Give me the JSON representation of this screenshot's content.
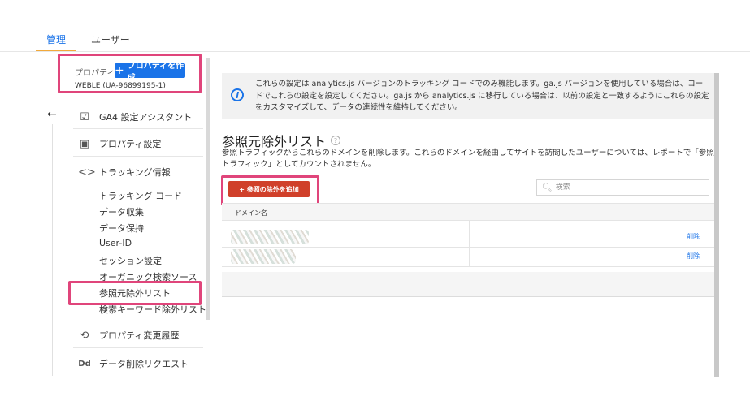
{
  "tabs": [
    {
      "label": "管理",
      "active": true
    },
    {
      "label": "ユーザー",
      "active": false
    }
  ],
  "sidebar": {
    "property_label": "プロパティ",
    "create_property_label": "プロパティを作成",
    "property_id": "WEBLE (UA-96899195-1)",
    "back_icon": "arrow-left-icon",
    "items": [
      {
        "label": "GA4 設定アシスタント",
        "icon": "checkbox-icon"
      },
      {
        "label": "プロパティ設定",
        "icon": "window-icon"
      },
      {
        "label": "トラッキング情報",
        "icon": "code-icon"
      }
    ],
    "tracking_sub_items": [
      "トラッキング コード",
      "データ収集",
      "データ保持",
      "User-ID",
      "セッション設定",
      "オーガニック検索ソース",
      "参照元除外リスト",
      "検索キーワード除外リスト"
    ],
    "bottom_items": [
      {
        "label": "プロパティ変更履歴",
        "icon": "history-icon"
      },
      {
        "label": "データ削除リクエスト",
        "icon": "dd-icon",
        "icon_text": "Dd"
      }
    ]
  },
  "main": {
    "info_text": "これらの設定は analytics.js バージョンのトラッキング コードでのみ機能します。ga.js バージョンを使用している場合は、コードでこれらの設定を設定してください。ga.js から analytics.js に移行している場合は、以前の設定と一致するようにこれらの設定をカスタマイズして、データの連続性を維持してください。",
    "title": "参照元除外リスト",
    "description": "参照トラフィックからこれらのドメインを削除します。これらのドメインを経由してサイトを訪問したユーザーについては、レポートで「参照トラフィック」としてカウントされません。",
    "add_button_label": "+ 参照の除外を追加",
    "search_placeholder": "検索",
    "table": {
      "column_header": "ドメイン名",
      "rows": [
        {
          "domain": "",
          "action": "削除"
        },
        {
          "domain": "",
          "action": "削除"
        }
      ]
    }
  },
  "colors": {
    "accent": "#1a73e8",
    "add_button": "#d0402a",
    "highlight": "#e0457b",
    "tab_underline": "#f2a93b"
  }
}
